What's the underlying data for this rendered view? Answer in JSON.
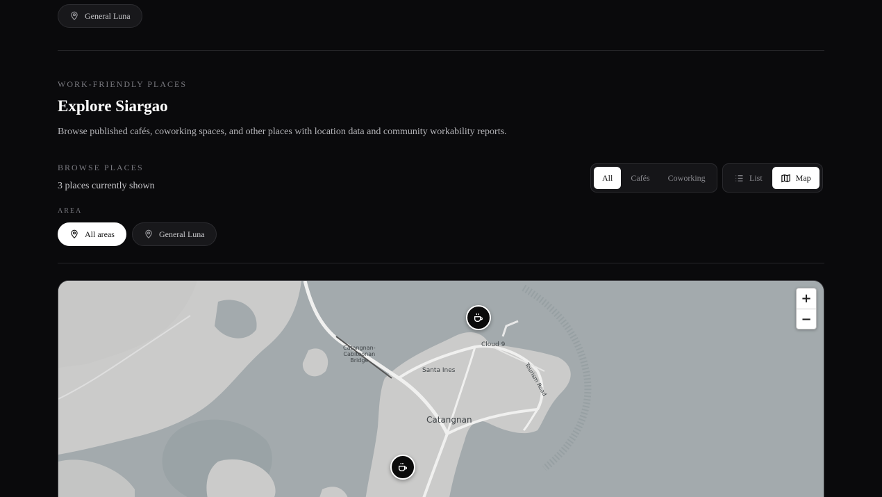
{
  "top_area_chip": {
    "label": "General Luna"
  },
  "hero": {
    "eyebrow": "WORK-FRIENDLY PLACES",
    "title": "Explore Siargao",
    "description": "Browse published cafés, coworking spaces, and other places with location data and community workability reports."
  },
  "browse": {
    "eyebrow": "BROWSE PLACES",
    "count_text": "3 places currently shown",
    "area_label": "AREA",
    "areas": [
      {
        "label": "All areas",
        "active": true
      },
      {
        "label": "General Luna",
        "active": false
      }
    ]
  },
  "filters": {
    "types": [
      {
        "label": "All",
        "active": true
      },
      {
        "label": "Cafés",
        "active": false
      },
      {
        "label": "Coworking",
        "active": false
      }
    ],
    "views": [
      {
        "label": "List",
        "icon": "list-icon",
        "active": false
      },
      {
        "label": "Map",
        "icon": "map-icon",
        "active": true
      }
    ]
  },
  "map": {
    "zoom_in": "+",
    "zoom_out": "−",
    "labels": {
      "bridge": "Catangnan-\nCabitoonan\nBridge",
      "cloud9": "Cloud 9",
      "santa_ines": "Santa Ines",
      "catangnan": "Catangnan",
      "tourism_road": "Tourism Road"
    },
    "marker_icon": "coffee-icon",
    "colors": {
      "water": "#a3aaad",
      "land": "#cbcbca",
      "road": "#f0f0ef",
      "mangrove": "#8f999d"
    }
  }
}
